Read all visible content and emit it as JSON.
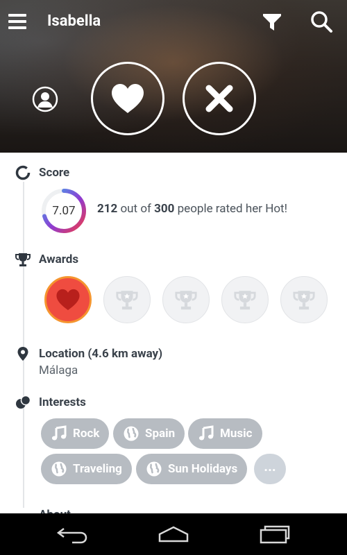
{
  "header": {
    "title": "Isabella",
    "icons": [
      "menu-icon",
      "filter-icon",
      "search-icon",
      "profile-icon",
      "heart-icon",
      "close-icon"
    ]
  },
  "score": {
    "title": "Score",
    "value": "7.07",
    "rated_count": "212",
    "rated_mid": " out of ",
    "rated_total": "300",
    "rated_suffix": " people rated her Hot!"
  },
  "awards": {
    "title": "Awards",
    "items": [
      {
        "icon": "heart-icon",
        "active": true
      },
      {
        "icon": "trophy-icon",
        "active": false
      },
      {
        "icon": "trophy-icon",
        "active": false
      },
      {
        "icon": "trophy-icon",
        "active": false
      },
      {
        "icon": "trophy-icon",
        "active": false
      }
    ]
  },
  "location": {
    "title": "Location (4.6 km away)",
    "city": "Málaga"
  },
  "interests": {
    "title": "Interests",
    "chips": [
      {
        "label": "Rock",
        "icon": "music-icon"
      },
      {
        "label": "Spain",
        "icon": "globe-icon"
      },
      {
        "label": "Music",
        "icon": "music-icon"
      },
      {
        "label": "Traveling",
        "icon": "globe-icon"
      },
      {
        "label": "Sun Holidays",
        "icon": "globe-icon"
      }
    ],
    "more_label": "..."
  },
  "about": {
    "title": "About"
  },
  "colors": {
    "accent_red": "#ef4c40",
    "accent_orange": "#f5952f",
    "chip_bg": "#b7bcc2",
    "ring_gradient": [
      "#3bb0f0",
      "#8f3bd1",
      "#ef3b4a"
    ]
  },
  "navbar": {
    "icons": [
      "back-icon",
      "home-icon",
      "recents-icon"
    ]
  }
}
